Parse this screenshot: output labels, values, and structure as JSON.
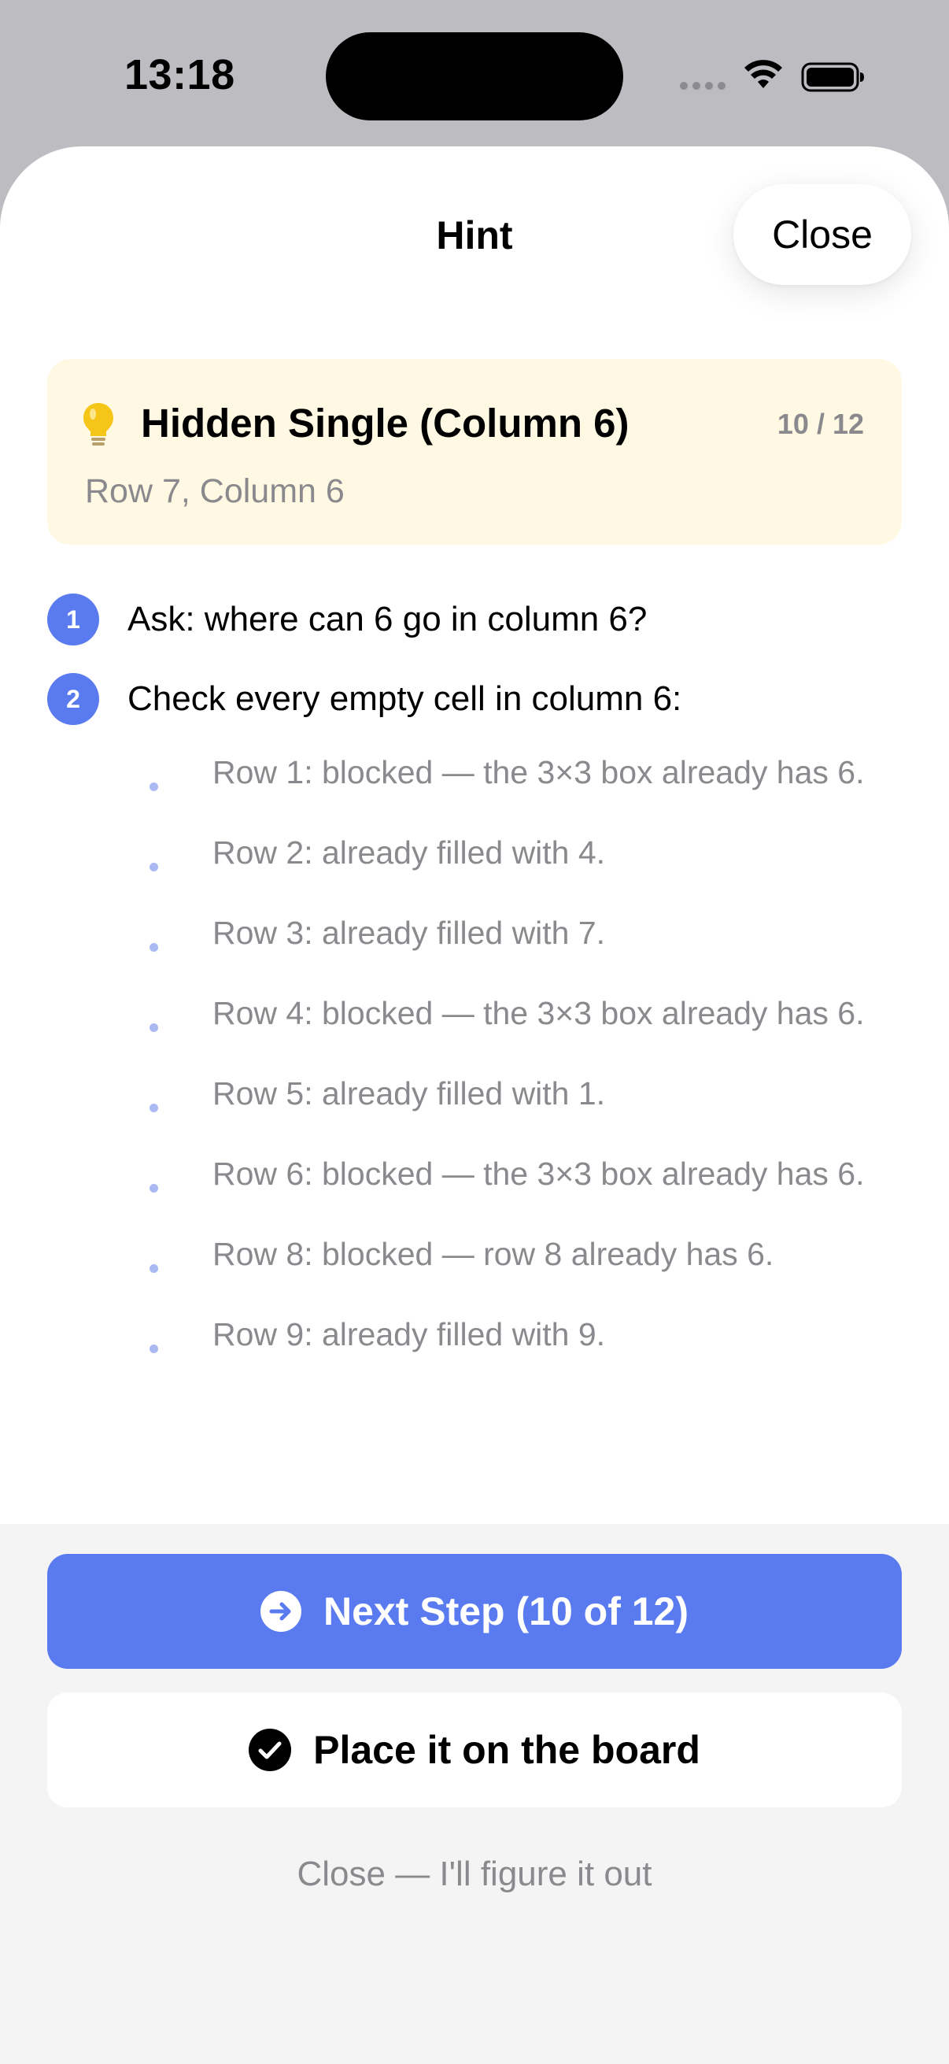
{
  "status_bar": {
    "time": "13:18"
  },
  "sheet": {
    "title": "Hint",
    "close_label": "Close"
  },
  "hint": {
    "technique": "Hidden Single (Column 6)",
    "counter": "10 / 12",
    "location": "Row 7, Column 6",
    "icon": "lightbulb-icon"
  },
  "steps": [
    {
      "number": "1",
      "text": "Ask: where can 6 go in column 6?"
    },
    {
      "number": "2",
      "text": "Check every empty cell in column 6:"
    }
  ],
  "sub_items": [
    "Row 1: blocked — the 3×3 box already has 6.",
    "Row 2: already filled with 4.",
    "Row 3: already filled with 7.",
    "Row 4: blocked — the 3×3 box already has 6.",
    "Row 5: already filled with 1.",
    "Row 6: blocked — the 3×3 box already has 6.",
    "Row 8: blocked — row 8 already has 6.",
    "Row 9: already filled with 9."
  ],
  "actions": {
    "next_step_label": "Next Step (10 of 12)",
    "place_label": "Place it on the board",
    "dismiss_label": "Close — I'll figure it out"
  },
  "colors": {
    "accent": "#5a7bef",
    "hint_card_bg": "#fff8e2",
    "secondary_text": "#8a8a8e"
  }
}
